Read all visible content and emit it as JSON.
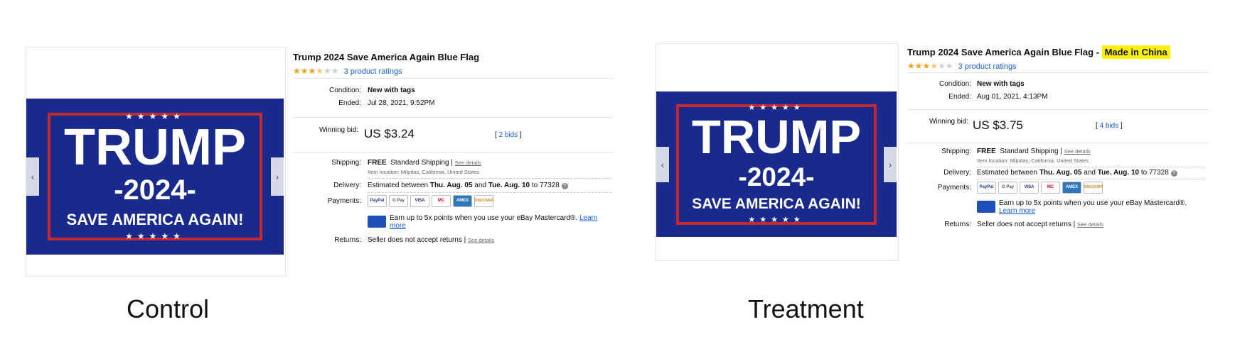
{
  "control": {
    "caption": "Control",
    "flag": {
      "word": "TRUMP",
      "year": "-2024-",
      "slogan": "SAVE AMERICA AGAIN!",
      "stars": "★★★★★"
    },
    "title": "Trump 2024 Save America Again Blue Flag",
    "rating": {
      "filled": "★★★",
      "half": "★",
      "empty": "★★",
      "link": "3 product ratings"
    },
    "condition_label": "Condition:",
    "condition": "New with tags",
    "ended_label": "Ended:",
    "ended": "Jul 28, 2021, 9:52PM",
    "bid_label": "Winning bid:",
    "price": "US $3.24",
    "bids_open": "[",
    "bids": "2 bids",
    "bids_close": "]",
    "shipping_label": "Shipping:",
    "shipping_free": "FREE",
    "shipping_text": "Standard Shipping |",
    "see_details": "See details",
    "item_location": "Item location:  Milpitas, California, United States",
    "delivery_label": "Delivery:",
    "delivery_prefix": "Estimated between",
    "delivery_start": "Thu. Aug. 05",
    "delivery_and": "and",
    "delivery_end": "Tue. Aug. 10",
    "delivery_to": "to 77328",
    "payments_label": "Payments:",
    "payment_methods": [
      "PayPal",
      "G Pay",
      "VISA",
      "MC",
      "AMEX",
      "DISCOVER"
    ],
    "mastercard_text": "Earn up to 5x points when you use your eBay Mastercard®.",
    "learn_more": "Learn more",
    "returns_label": "Returns:",
    "returns": "Seller does not accept returns |",
    "returns_details": "See details"
  },
  "treatment": {
    "caption": "Treatment",
    "flag": {
      "word": "TRUMP",
      "year": "-2024-",
      "slogan": "SAVE AMERICA AGAIN!",
      "stars": "★★★★★"
    },
    "title": "Trump 2024 Save America Again Blue Flag -",
    "title_highlight": "Made in China",
    "rating": {
      "filled": "★★★",
      "half": "★",
      "empty": "★★",
      "link": "3 product ratings"
    },
    "condition_label": "Condition:",
    "condition": "New with tags",
    "ended_label": "Ended:",
    "ended": "Aug 01, 2021, 4:13PM",
    "bid_label": "Winning bid:",
    "price": "US $3.75",
    "bids_open": "[",
    "bids": "4 bids",
    "bids_close": "]",
    "shipping_label": "Shipping:",
    "shipping_free": "FREE",
    "shipping_text": "Standard Shipping |",
    "see_details": "See details",
    "item_location": "Item location:  Milpitas, California, United States",
    "delivery_label": "Delivery:",
    "delivery_prefix": "Estimated between",
    "delivery_start": "Thu. Aug. 05",
    "delivery_and": "and",
    "delivery_end": "Tue. Aug. 10",
    "delivery_to": "to 77328",
    "payments_label": "Payments:",
    "payment_methods": [
      "PayPal",
      "G Pay",
      "VISA",
      "MC",
      "AMEX",
      "DISCOVER"
    ],
    "mastercard_text": "Earn up to 5x points when you use your eBay Mastercard®.",
    "learn_more": "Learn more",
    "returns_label": "Returns:",
    "returns": "Seller does not accept returns |",
    "returns_details": "See details"
  },
  "colors": {
    "flag_blue": "#1a2a8c",
    "flag_red": "#c8282d",
    "star_orange": "#f4a21a",
    "link_blue": "#1a5fd6",
    "highlight": "#fff200"
  }
}
